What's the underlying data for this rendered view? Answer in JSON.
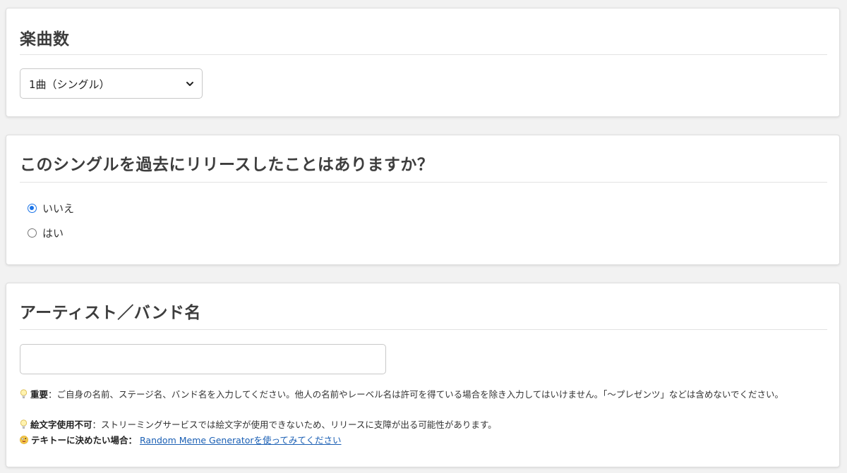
{
  "track_count": {
    "title": "楽曲数",
    "selected_option": "1曲（シングル）"
  },
  "released_before": {
    "title": "このシングルを過去にリリースしたことはありますか？",
    "options": [
      {
        "label": "いいえ",
        "checked": true
      },
      {
        "label": "はい",
        "checked": false
      }
    ]
  },
  "artist_name": {
    "title": "アーティスト／バンド名",
    "input_value": "",
    "notes": {
      "important_label": "重要",
      "important_text": "：ご自身の名前、ステージ名、バンド名を入力してください。他人の名前やレーベル名は許可を得ている場合を除き入力してはいけません。「〜プレゼンツ」などは含めないでください。",
      "no_emoji_label": "絵文字使用不可",
      "no_emoji_text": "：ストリーミングサービスでは絵文字が使用できないため、リリースに支障が出る可能性があります。",
      "random_label": "テキトーに決めたい場合：",
      "random_link": "Random Meme Generatorを使ってみてください"
    }
  },
  "icons": {
    "select_arrow": "chevron-down-icon",
    "note_1": "lightbulb-icon",
    "note_2": "lightbulb-icon",
    "note_3": "zany-face-icon"
  },
  "colors": {
    "accent": "#1a73e8",
    "link": "#1a5fb4"
  }
}
